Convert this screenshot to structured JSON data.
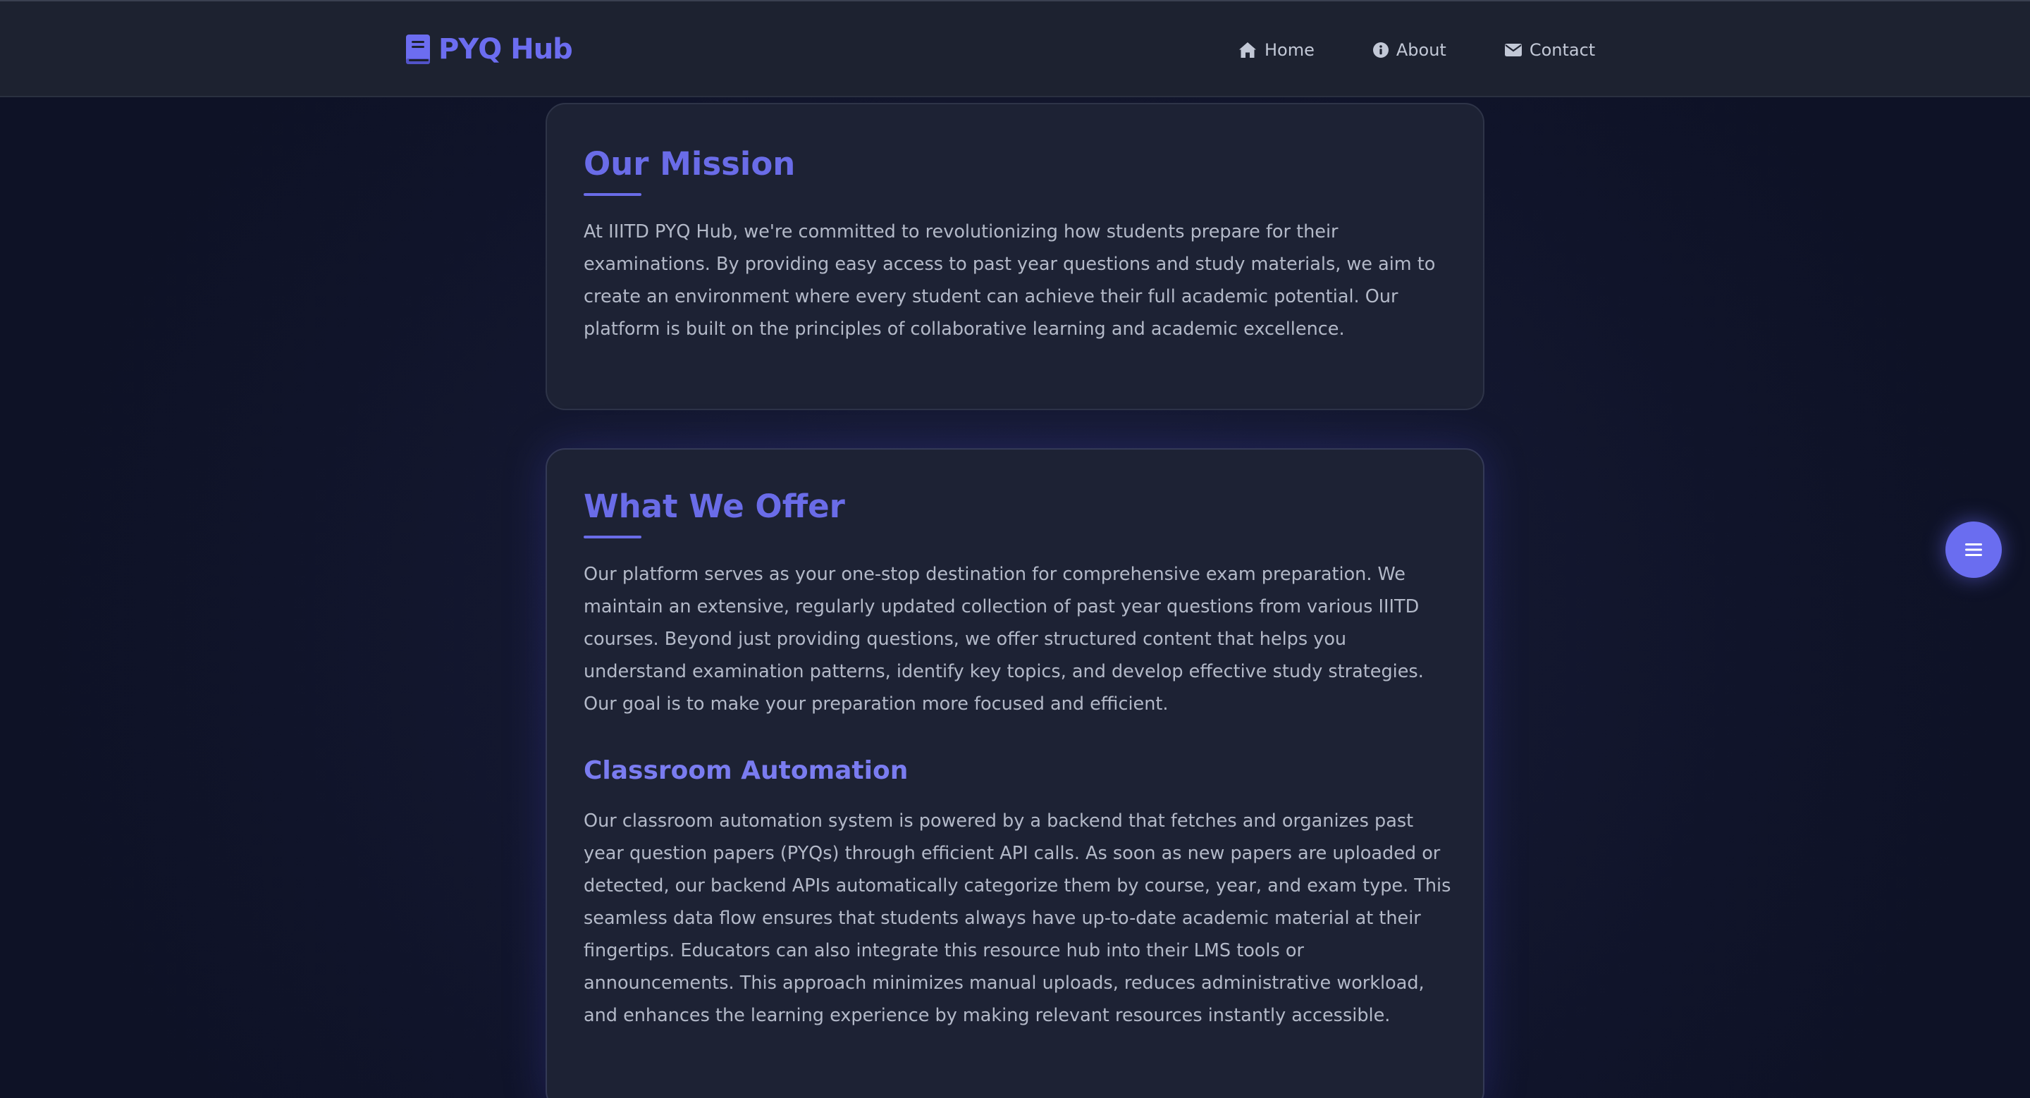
{
  "navbar": {
    "brand": "PYQ Hub",
    "links": [
      {
        "label": "Home",
        "icon": "home-icon"
      },
      {
        "label": "About",
        "icon": "info-icon"
      },
      {
        "label": "Contact",
        "icon": "envelope-icon"
      }
    ]
  },
  "mission": {
    "title": "Our Mission",
    "text": "At IIITD PYQ Hub, we're committed to revolutionizing how students prepare for their examinations. By providing easy access to past year questions and study materials, we aim to create an environment where every student can achieve their full academic potential. Our platform is built on the principles of collaborative learning and academic excellence."
  },
  "offer": {
    "title": "What We Offer",
    "text": "Our platform serves as your one-stop destination for comprehensive exam preparation. We maintain an extensive, regularly updated collection of past year questions from various IIITD courses. Beyond just providing questions, we offer structured content that helps you understand examination patterns, identify key topics, and develop effective study strategies. Our goal is to make your preparation more focused and efficient.",
    "subtitle": "Classroom Automation",
    "subtext": "Our classroom automation system is powered by a backend that fetches and organizes past year question papers (PYQs) through efficient API calls. As soon as new papers are uploaded or detected, our backend APIs automatically categorize them by course, year, and exam type. This seamless data flow ensures that students always have up-to-date academic material at their fingertips. Educators can also integrate this resource hub into their LMS tools or announcements. This approach minimizes manual uploads, reduces administrative workload, and enhances the learning experience by making relevant resources instantly accessible."
  },
  "fab": {
    "icon": "menu-lines-icon"
  },
  "colors": {
    "accent": "#6a6ce8",
    "background": "#141830",
    "card": "#1d2234",
    "navbar": "#1d2230",
    "text": "#b3b9c8"
  }
}
